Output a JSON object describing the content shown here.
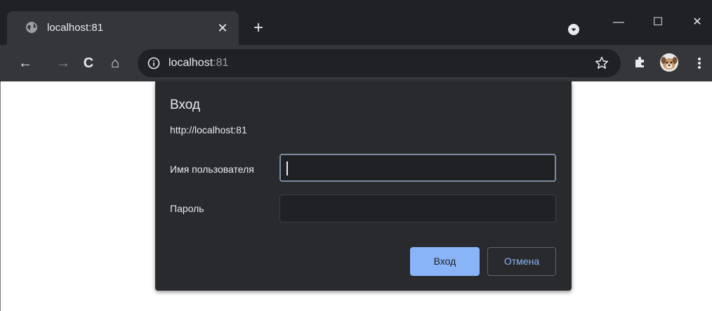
{
  "tab": {
    "title": "localhost:81",
    "close_glyph": "✕",
    "favicon": "globe-icon"
  },
  "new_tab_glyph": "+",
  "window_controls": {
    "minimize": "—",
    "maximize": "☐",
    "close": "✕"
  },
  "toolbar": {
    "back": "←",
    "forward": "→",
    "reload": "C",
    "home": "⌂"
  },
  "omnibox": {
    "host": "localhost",
    "port": ":81"
  },
  "dialog": {
    "title": "Вход",
    "origin": "http://localhost:81",
    "username_label": "Имя пользователя",
    "password_label": "Пароль",
    "username_value": "",
    "password_value": "",
    "ok_label": "Вход",
    "cancel_label": "Отмена"
  },
  "colors": {
    "tabstrip_bg": "#202124",
    "toolbar_bg": "#35363a",
    "dialog_bg": "#292a2d",
    "accent": "#8ab4f8",
    "text": "#e8eaed"
  }
}
